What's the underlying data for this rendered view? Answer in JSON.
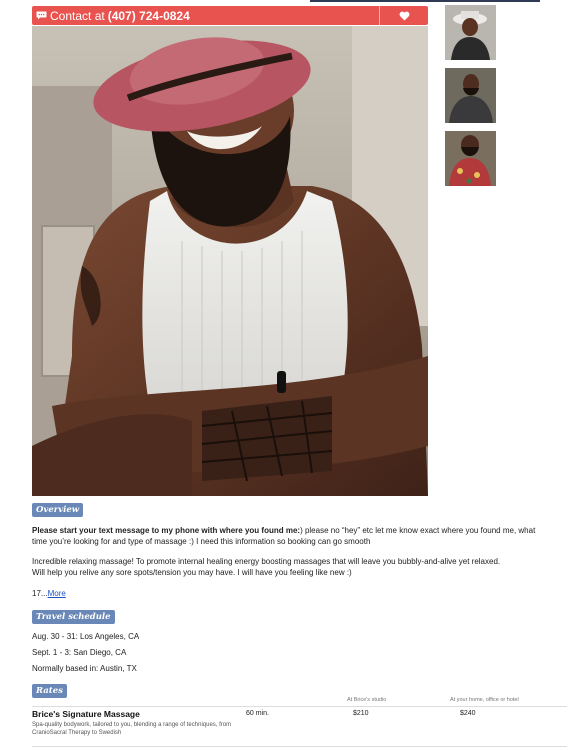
{
  "contact": {
    "prefix": "Contact at",
    "phone": "(407) 724-0824"
  },
  "colors": {
    "accent": "#e8534f",
    "tag": "#6a88b7"
  },
  "icons": {
    "contact": "chat-bubble-icon",
    "favorite": "heart-icon"
  },
  "sections": {
    "overview": {
      "label": "Overview",
      "intro_bold": "Please start your text message to my phone with where you found me:",
      "intro_rest": ") please no “hey” etc let me know exact where you found me, what time you’re looking for and type of massage :) I need this information so booking can go smooth",
      "para2_line1": "Incredible relaxing massage! To promote internal healing energy boosting massages that will leave you bubbly-and-alive yet relaxed.",
      "para2_line2": "Will help you relive any sore spots/tension you may have. I will have you feeling like new :)",
      "truncated": "17...",
      "more_link": "More"
    },
    "travel": {
      "label": "Travel schedule",
      "entries": [
        "Aug. 30 - 31: Los Angeles, CA",
        "Sept. 1 - 3: San Diego, CA"
      ],
      "based_in": "Normally based in: Austin, TX"
    },
    "rates": {
      "label": "Rates",
      "col_studio": "At Brice's studio",
      "col_outcall": "At your home, office or hotel",
      "items": [
        {
          "name": "Brice's Signature Massage",
          "description": "Spa-quality bodywork, tailored to you, blending a range of techniques, from CranioSacral Therapy to Swedish",
          "duration": "60 min.",
          "studio_price": "$210",
          "outcall_price": "$240"
        }
      ]
    }
  }
}
